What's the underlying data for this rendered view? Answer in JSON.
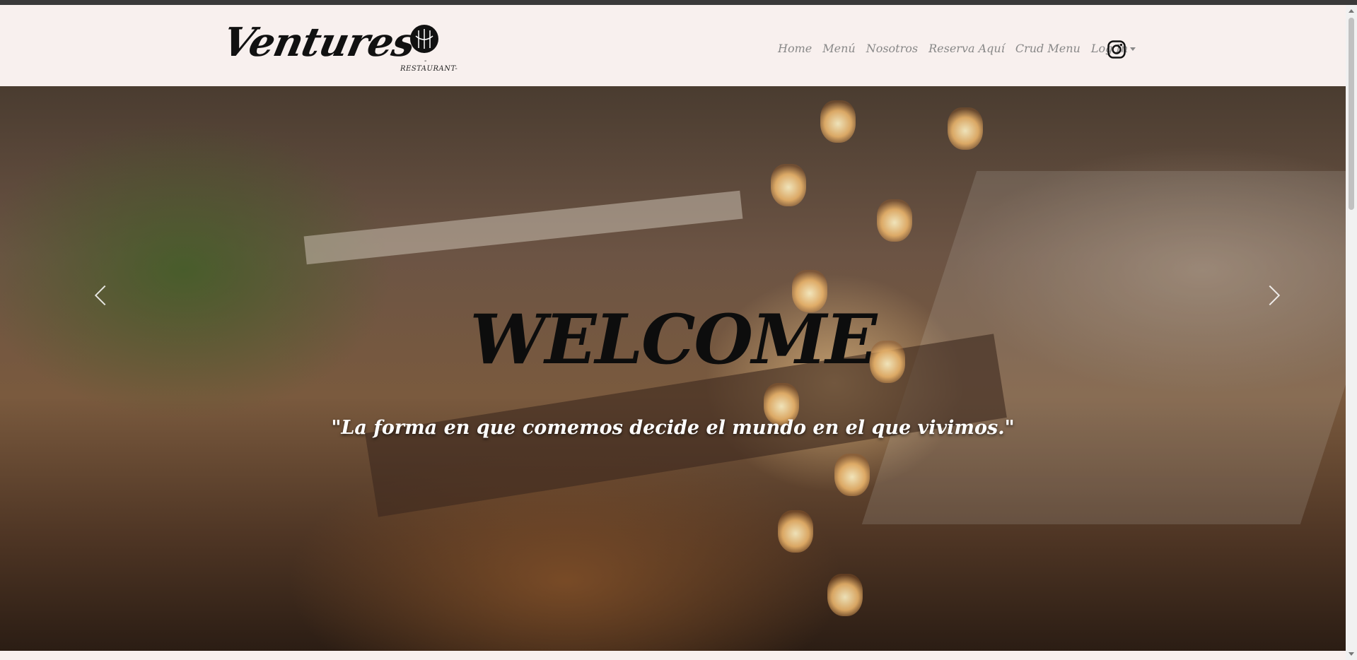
{
  "brand": {
    "name": "Ventures",
    "logo_sub": "-RESTAURANT-"
  },
  "nav": {
    "items": [
      {
        "label": "Home"
      },
      {
        "label": "Menú"
      },
      {
        "label": "Nosotros"
      },
      {
        "label": "Reserva Aquí"
      },
      {
        "label": "Crud Menu"
      }
    ],
    "login_label": "Log In",
    "social_icon": "instagram-icon"
  },
  "hero": {
    "title": "WELCOME",
    "tagline": "\"La forma en que comemos decide el mundo en el que vivimos.\"",
    "prev_icon": "chevron-left-icon",
    "next_icon": "chevron-right-icon"
  },
  "colors": {
    "navbar_bg": "#f8f0ee",
    "nav_text": "#888888",
    "title_text": "#0d0d0d",
    "tagline_text": "#ffffff"
  }
}
